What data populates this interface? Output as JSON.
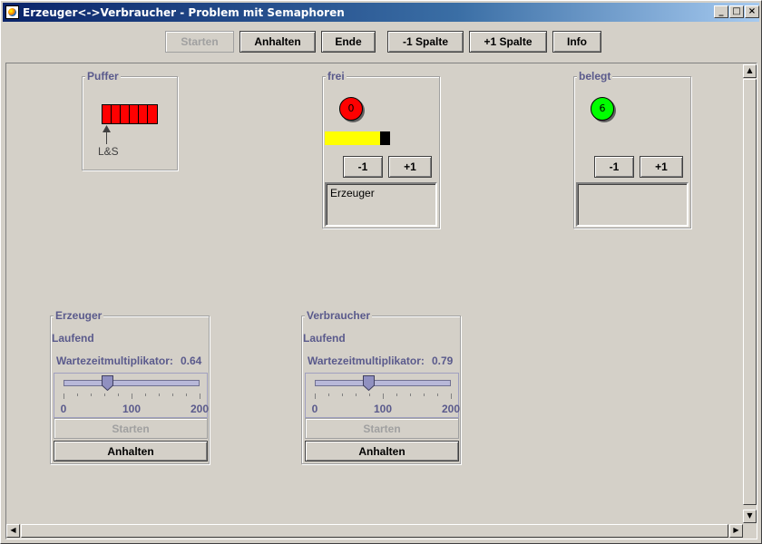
{
  "window": {
    "title": "Erzeuger<->Verbraucher - Problem mit Semaphoren"
  },
  "toolbar": {
    "start": "Starten",
    "stop": "Anhalten",
    "end": "Ende",
    "minus_col": "-1 Spalte",
    "plus_col": "+1 Spalte",
    "info": "Info"
  },
  "puffer": {
    "title": "Puffer",
    "slots": 6,
    "pointer_label": "L&S"
  },
  "frei": {
    "title": "frei",
    "count": "0",
    "minus": "-1",
    "plus": "+1",
    "waiting": "Erzeuger",
    "led_color": "#ff0000",
    "bar_fill": 0.86
  },
  "belegt": {
    "title": "belegt",
    "count": "6",
    "minus": "-1",
    "plus": "+1",
    "waiting": "",
    "led_color": "#00ff00"
  },
  "erzeuger": {
    "title": "Erzeuger",
    "status": "Laufend",
    "multiplier_label": "Wartezeitmultiplikator:",
    "multiplier_value": "0.64",
    "slider_value": 64,
    "ticks": [
      "0",
      "100",
      "200"
    ],
    "start": "Starten",
    "stop": "Anhalten"
  },
  "verbraucher": {
    "title": "Verbraucher",
    "status": "Laufend",
    "multiplier_label": "Wartezeitmultiplikator:",
    "multiplier_value": "0.79",
    "slider_value": 79,
    "ticks": [
      "0",
      "100",
      "200"
    ],
    "start": "Starten",
    "stop": "Anhalten"
  }
}
